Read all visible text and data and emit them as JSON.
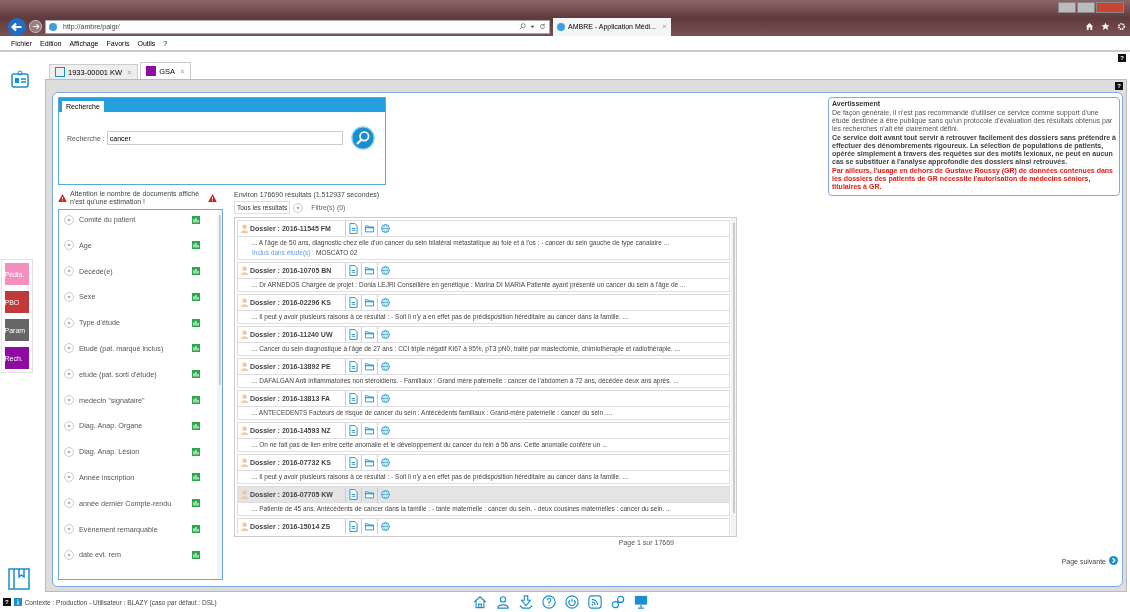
{
  "browser": {
    "address": "http://ambre/paigr/",
    "tab_title": "AMBRE - Application Médi...",
    "menu": [
      "Fichier",
      "Edition",
      "Affichage",
      "Favoris",
      "Outils",
      "?"
    ]
  },
  "app_tabs": [
    {
      "label": "1933-00001 KW",
      "selected": false
    },
    {
      "label": "GSA",
      "selected": true
    }
  ],
  "help_mark": "?",
  "side_buttons": [
    {
      "label": "Pédia.",
      "color": "#f48fc0"
    },
    {
      "label": "PBO",
      "color": "#c0393b"
    },
    {
      "label": "Param",
      "color": "#666666"
    },
    {
      "label": "Rech.",
      "color": "#8e0aa0"
    }
  ],
  "search": {
    "tab": "Recherche",
    "label": "Recherche :",
    "value": "cancer"
  },
  "warning": {
    "title": "Avertissement",
    "paragraphs": [
      {
        "kind": "plain",
        "text": "De façon générale, il n'est pas recommandé d'utiliser ce service comme support d'une étude destinée à être publique sans qu'un protocole d'évaluation des résultats obtenus par les recherches n'ait été clairement défini."
      },
      {
        "kind": "bold",
        "text": "Ce service doit avant tout servir à retrouver facilement des dossiers sans prétendre à effectuer des dénombrements rigoureux. La sélection de populations de patients, opérée simplement à travers des requêtes sur des motifs lexicaux, ne peut en aucun cas se substituer à l'analyse approfondie des dossiers ainsi retrouvés."
      },
      {
        "kind": "alert",
        "text": "Par ailleurs, l'usage en dehors de Gustave Roussy (GR) de données contenues dans les dossiers des patients de GR nécessite l'autorisation de médecins séniors, titulaires à GR."
      }
    ]
  },
  "facet_notice": "Attention le nombre de documents affiché n'est qu'une estimation !",
  "facets": [
    "Comité du patient",
    "Age",
    "Décédé(e)",
    "Sexe",
    "Type d'étude",
    "Etude (pat. marqué inclus)",
    "etude (pat. sorti d'étude)",
    "medecin \"signataire\"",
    "Diag. Anap. Organe",
    "Diag. Anap. Lésion",
    "Année inscription",
    "année dernier Compte-rendu",
    "Evènement remarquable",
    "date evt. rem"
  ],
  "results": {
    "summary": "Environ 176690 résultats (1.512937 secondes)",
    "all_button": "Tous les résultats",
    "filters": "Filtre(s) (0)",
    "rows": [
      {
        "dossier": "Dossier : 2016-11545 FM",
        "selected": false,
        "snippet": "... A l'âge de 50 ans, diagnostic chez elle d'un cancer du sein bilatéral métastatique au foie et à l'os : - cancer du sein gauche de type canalaire ...",
        "study_label": "Inclus dans étude(s) :",
        "study": "MOSCATO 02"
      },
      {
        "dossier": "Dossier : 2016-10705 BN",
        "selected": false,
        "snippet": "... Dr ARNEDOS Chargée de projet : Donia LEJRI Conseillère en génétique : Marina DI MARIA Patiente ayant présenté un cancer du sein à l'âge de ..."
      },
      {
        "dossier": "Dossier : 2016-02296 KS",
        "selected": false,
        "snippet": "... Il peut y avoir plusieurs raisons à ce résultat : - Soit il n'y a en effet pas de prédisposition héréditaire au cancer dans la famille. ..."
      },
      {
        "dossier": "Dossier : 2016-11240 UW",
        "selected": false,
        "snippet": "... Cancer du sein diagnostiqué à l'âge de 27 ans : CCI triple négatif Ki67 à 95%, pT3 pN0, traité par mastectomie, chimiothérapie et radiothérapie. ..."
      },
      {
        "dossier": "Dossier : 2016-13892 PE",
        "selected": false,
        "snippet": "... DAFALGAN Anti inflammatoires non stéroidiens. - Familiaux : Grand mère paternelle : cancer de l'abdomen à 72 ans, décédée deux ans après. ..."
      },
      {
        "dossier": "Dossier : 2016-13813 FA",
        "selected": false,
        "snippet": "... ANTECEDENTS Facteurs de risque de cancer du sein : Antécédents familiaux : Grand-mère paternelle : cancer du sein. ..."
      },
      {
        "dossier": "Dossier : 2016-14593 NZ",
        "selected": false,
        "snippet": "... On ne fait pas de lien entre cette anomalie et le développement du cancer du rein à 56 ans. Cette anomalie confère un ..."
      },
      {
        "dossier": "Dossier : 2016-07732 KS",
        "selected": false,
        "snippet": "... Il peut y avoir plusieurs raisons à ce résultat : - Soit il n'y a en effet pas de prédisposition héréditaire au cancer dans la famille. ..."
      },
      {
        "dossier": "Dossier : 2016-07705 KW",
        "selected": true,
        "snippet": "... Patiente de 45 ans. Antécédents de cancer dans la famille : - tante maternelle : cancer du sein. - deux cousines maternelles : cancer du sein. ..."
      },
      {
        "dossier": "Dossier : 2016-15014 ZS",
        "selected": false
      }
    ],
    "page": "Page 1 sur 17669",
    "next": "Page suivante"
  },
  "status": "Contexte : Production - Utilisateur : BLAZY (caso par défaut : DSL)"
}
